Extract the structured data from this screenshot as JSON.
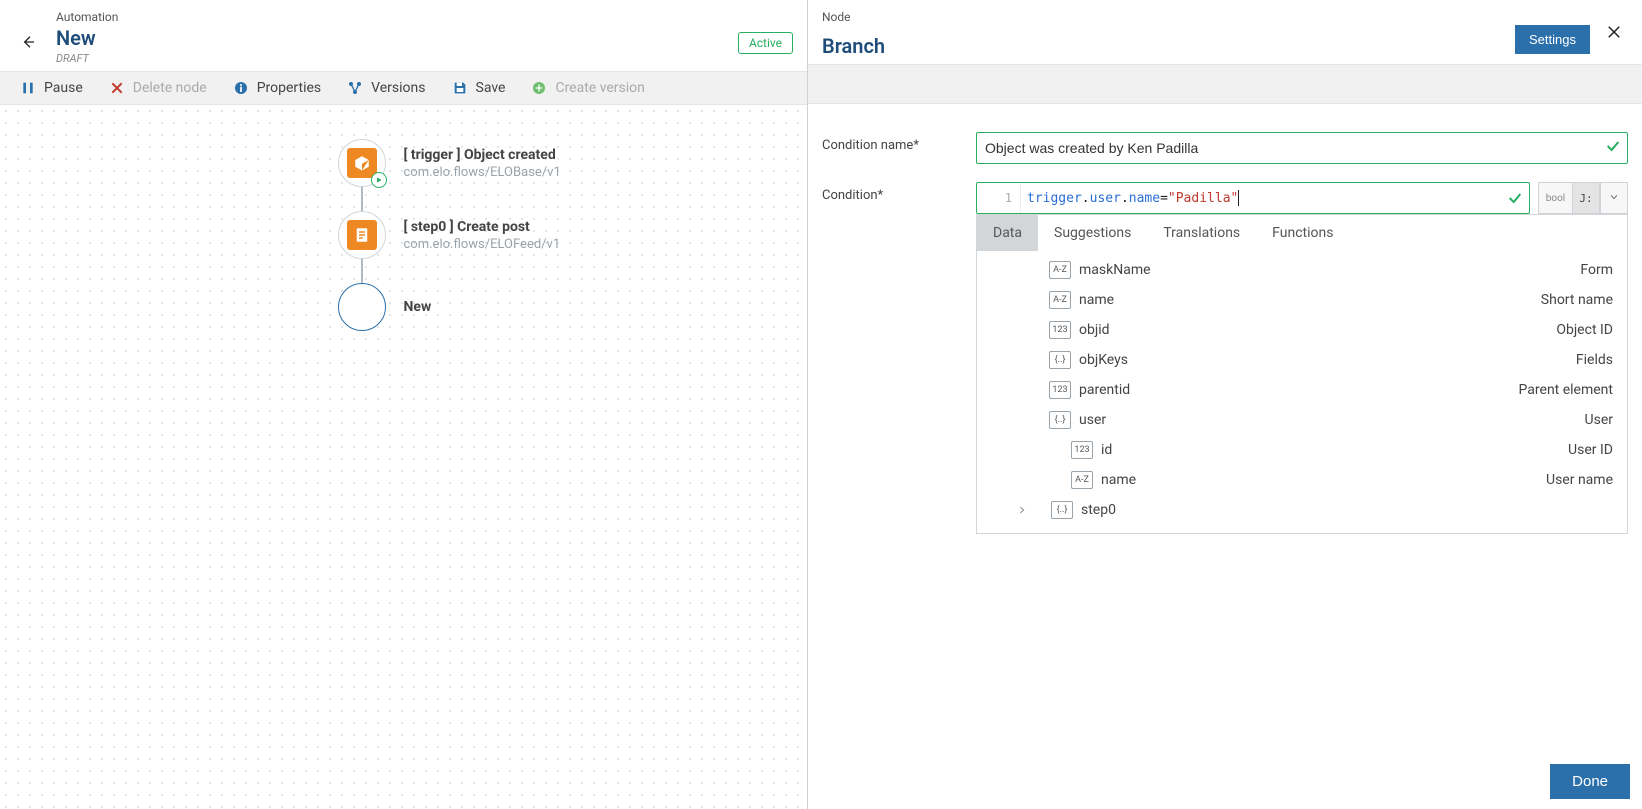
{
  "left": {
    "kicker": "Automation",
    "title": "New",
    "subtitle": "DRAFT",
    "status": "Active"
  },
  "toolbar": {
    "pause": "Pause",
    "delete": "Delete node",
    "properties": "Properties",
    "versions": "Versions",
    "save": "Save",
    "create_version": "Create version"
  },
  "nodes": [
    {
      "title": "[ trigger ] Object created",
      "sub": "com.elo.flows/ELOBase/v1"
    },
    {
      "title": "[ step0 ] Create post",
      "sub": "com.elo.flows/ELOFeed/v1"
    },
    {
      "title": "New",
      "sub": ""
    }
  ],
  "right": {
    "kicker": "Node",
    "title": "Branch",
    "settings": "Settings"
  },
  "form": {
    "name_label": "Condition name*",
    "name_value": "Object was created by Ken Padilla",
    "cond_label": "Condition*",
    "code": {
      "line_no": "1",
      "seg1": "trigger",
      "seg2": "user",
      "seg3": "name",
      "op": "=",
      "str": "\"Padilla\""
    },
    "chip_bool": "bool",
    "chip_js": "J:"
  },
  "tabs": [
    "Data",
    "Suggestions",
    "Translations",
    "Functions"
  ],
  "tree": [
    {
      "indent": 0,
      "type": "A-Z",
      "key": "maskName",
      "desc": "Form"
    },
    {
      "indent": 0,
      "type": "A-Z",
      "key": "name",
      "desc": "Short name"
    },
    {
      "indent": 0,
      "type": "123",
      "key": "objid",
      "desc": "Object ID"
    },
    {
      "indent": 0,
      "type": "{..}",
      "key": "objKeys",
      "desc": "Fields"
    },
    {
      "indent": 0,
      "type": "123",
      "key": "parentid",
      "desc": "Parent element"
    },
    {
      "indent": 0,
      "type": "{..}",
      "key": "user",
      "desc": "User"
    },
    {
      "indent": 1,
      "type": "123",
      "key": "id",
      "desc": "User ID"
    },
    {
      "indent": 1,
      "type": "A-Z",
      "key": "name",
      "desc": "User name"
    }
  ],
  "tree_step0": {
    "type": "{..}",
    "key": "step0"
  },
  "footer": {
    "done": "Done"
  }
}
